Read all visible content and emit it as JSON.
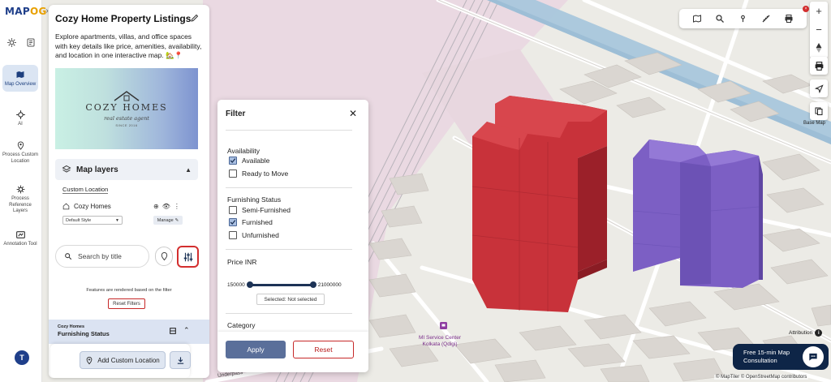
{
  "app": {
    "logo_main": "MAP",
    "logo_accent": "OG"
  },
  "rail": {
    "items": [
      {
        "label": "Map Overview",
        "icon": "map-icon",
        "active": true
      },
      {
        "label": "AI",
        "icon": "ai-icon",
        "active": false
      },
      {
        "label": "Process Custom Location",
        "icon": "location-pin-icon",
        "active": false
      },
      {
        "label": "Process Reference Layers",
        "icon": "layers-process-icon",
        "active": false
      },
      {
        "label": "Annotation Tool",
        "icon": "annotation-icon",
        "active": false
      }
    ],
    "avatar_initial": "T"
  },
  "panel": {
    "title": "Cozy Home Property Listings",
    "description": "Explore apartments, villas, and office spaces with key details like price, amenities, availability, and location in one interactive map. 🏡📍",
    "banner": {
      "title": "COZY HOMES",
      "subtitle": "real estate agent",
      "since": "SINCE 2016"
    },
    "layers_header": "Map layers",
    "custom_location_label": "Custom Location",
    "layer_name": "Cozy Homes",
    "style_select_value": "Default Style",
    "manage_label": "Manage",
    "search_placeholder": "Search by title",
    "filter_note": "Features are rendered based on the filter",
    "reset_filters_label": "Reset Filters",
    "furnishing_group_parent": "Cozy Homes",
    "furnishing_group_title": "Furnishing Status",
    "add_custom_location_label": "Add Custom Location"
  },
  "filter": {
    "title": "Filter",
    "availability_label": "Availability",
    "availability_options": [
      {
        "label": "Available",
        "checked": true
      },
      {
        "label": "Ready to Move",
        "checked": false
      }
    ],
    "furnishing_label": "Furnishing Status",
    "furnishing_options": [
      {
        "label": "Semi-Furnished",
        "checked": false
      },
      {
        "label": "Furnished",
        "checked": true
      },
      {
        "label": "Unfurnished",
        "checked": false
      }
    ],
    "price_label": "Price INR",
    "price_min": "150000",
    "price_max": "21000000",
    "selected_text": "Selected: Not selected",
    "category_label": "Category",
    "apply_label": "Apply",
    "reset_label": "Reset"
  },
  "toolbar": {
    "icons": [
      "map-view-icon",
      "search-icon",
      "location-icon",
      "measure-icon",
      "print-icon"
    ],
    "badge": "×"
  },
  "right_tools": {
    "zoom_in": "+",
    "zoom_out": "−",
    "basemap_label": "Base Map"
  },
  "map": {
    "poi_label_line1": "MI Service Center",
    "poi_label_line2": "Kolkata (Qdigi)",
    "road_label": "Underpass",
    "attribution_label": "Attribution",
    "credits": "© MapTiler © OpenStreetMap contributors",
    "consult_line1": "Free 15-min Map",
    "consult_line2": "Consultation",
    "colors": {
      "building_red": "#c8323a",
      "building_purple": "#7c5fc4",
      "water": "#a9c7dc",
      "base": "#ecebe6"
    }
  }
}
